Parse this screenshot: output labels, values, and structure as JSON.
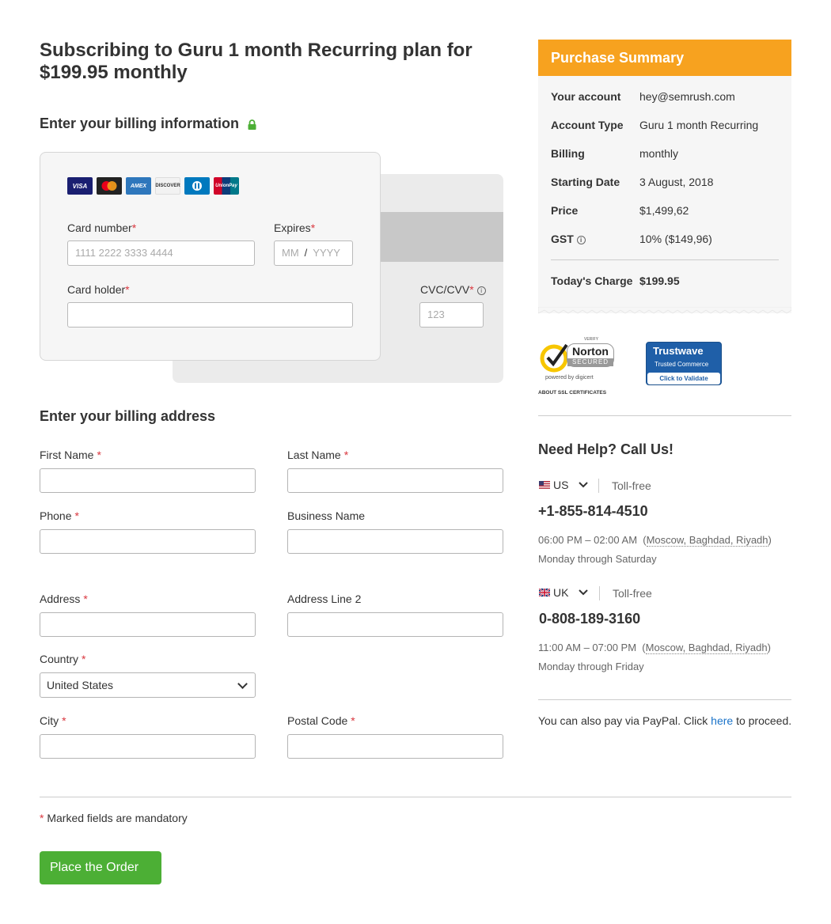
{
  "page_title": "Subscribing to Guru 1 month Recurring plan for $199.95 monthly",
  "billing_info": {
    "heading": "Enter your billing information",
    "brands": [
      "VISA",
      "",
      "AMEX",
      "DISCOVER",
      "",
      "UnionPay"
    ],
    "card_number_label": "Card number",
    "card_number_placeholder": "1111  2222  3333  4444",
    "expires_label": "Expires",
    "expires_month_placeholder": "MM",
    "expires_sep": "/",
    "expires_year_placeholder": "YYYY",
    "card_holder_label": "Card holder",
    "cvc_label": "CVC/CVV",
    "cvc_placeholder": "123"
  },
  "billing_address": {
    "heading": "Enter your billing address",
    "first_name": "First Name",
    "last_name": "Last Name",
    "phone": "Phone",
    "business_name": "Business Name",
    "address": "Address",
    "address_line2": "Address Line 2",
    "country": "Country",
    "country_value": "United States",
    "city": "City",
    "postal_code": "Postal Code",
    "req_mark": "*"
  },
  "mandatory_note": "Marked fields are mandatory",
  "place_order": "Place the Order",
  "summary": {
    "title": "Purchase Summary",
    "rows": [
      {
        "k": "Your account",
        "v": "hey@semrush.com"
      },
      {
        "k": "Account Type",
        "v": "Guru 1 month Recurring"
      },
      {
        "k": "Billing",
        "v": "monthly"
      },
      {
        "k": "Starting Date",
        "v": "3 August, 2018"
      },
      {
        "k": "Price",
        "v": "$1,499,62"
      },
      {
        "k": "GST",
        "v": "10% ($149,96)"
      }
    ],
    "total_label": "Today's Charge",
    "total_value": "$199.95"
  },
  "badges": {
    "norton_verify": "VERIFY",
    "norton_name": "Norton",
    "norton_secured": "SECURED",
    "norton_powered": "powered by digicert",
    "norton_about": "ABOUT SSL CERTIFICATES",
    "trustwave_name": "Trustwave",
    "trustwave_sub": "Trusted Commerce",
    "trustwave_cta": "Click to Validate"
  },
  "help": {
    "heading": "Need Help? Call Us!",
    "us": {
      "country": "US",
      "tollfree": "Toll-free",
      "phone": "+1-855-814-4510",
      "hours": "06:00 PM – 02:00 AM",
      "tz": "Moscow, Baghdad, Riyadh",
      "days": "Monday through Saturday"
    },
    "uk": {
      "country": "UK",
      "tollfree": "Toll-free",
      "phone": "0-808-189-3160",
      "hours": "11:00 AM – 07:00 PM",
      "tz": "Moscow, Baghdad, Riyadh",
      "days": "Monday through Friday"
    },
    "paypal_prefix": "You can also pay via PayPal. Click",
    "paypal_link": "here",
    "paypal_suffix": "to proceed."
  },
  "colors": {
    "accent": "#f7a21f",
    "button": "#4caf35",
    "link": "#1a73c9",
    "required": "#d9363e"
  }
}
